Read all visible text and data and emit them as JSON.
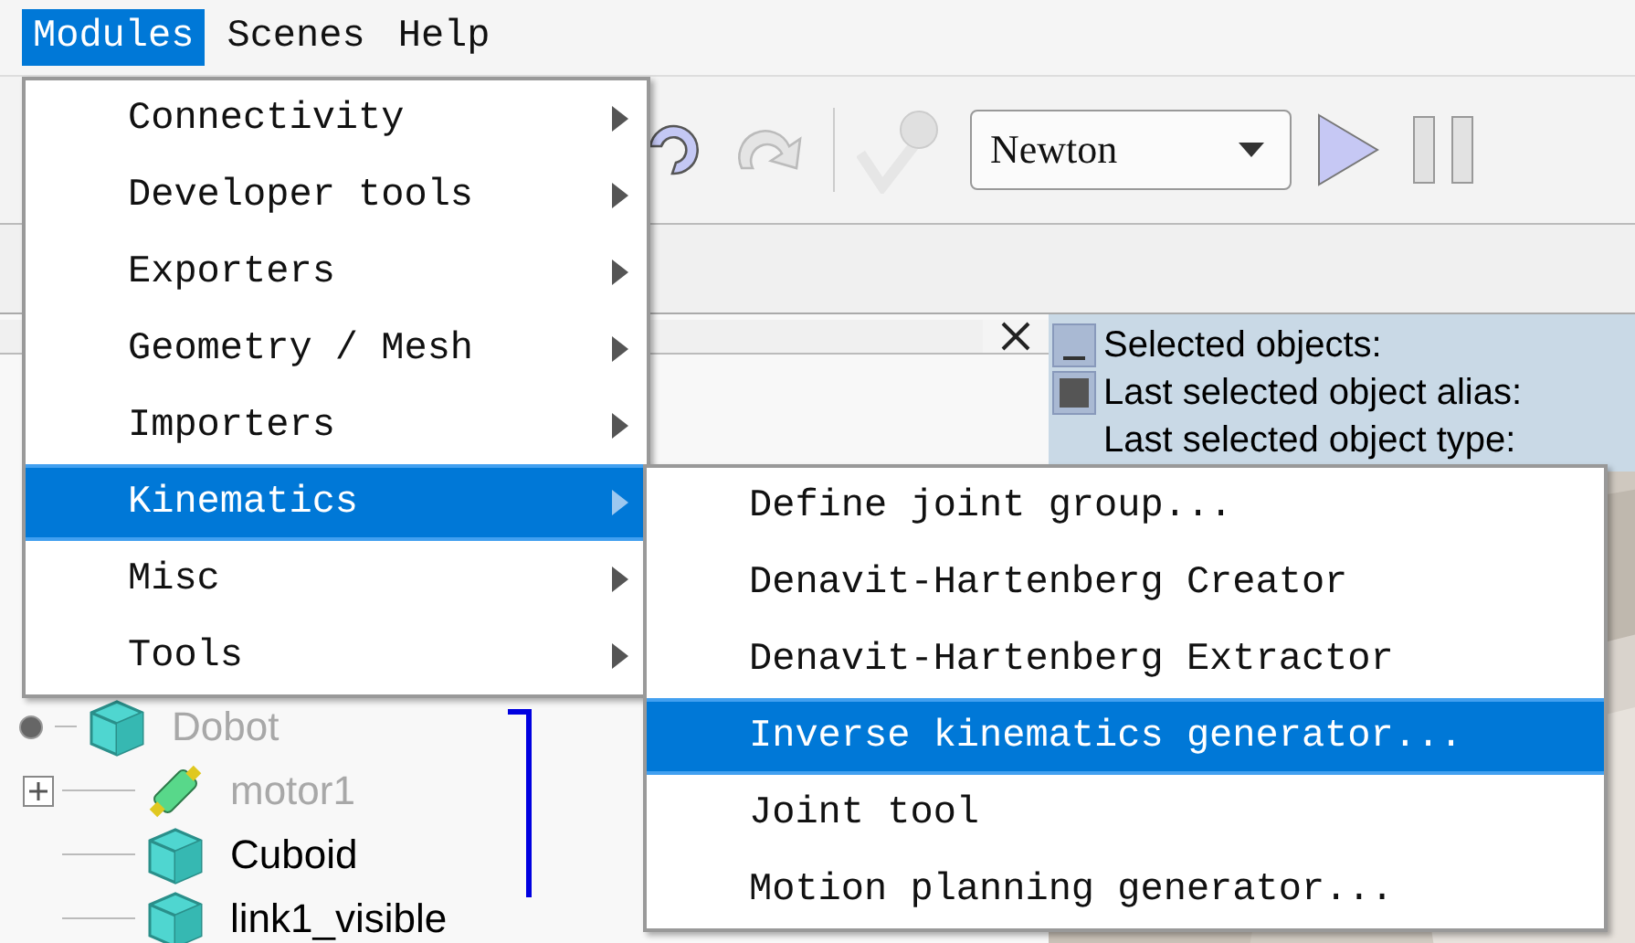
{
  "menubar": [
    {
      "label": "Modules",
      "selected": true
    },
    {
      "label": "Scenes",
      "selected": false
    },
    {
      "label": "Help",
      "selected": false
    }
  ],
  "toolbar": {
    "engine": "Newton"
  },
  "menu": [
    {
      "label": "Connectivity",
      "submenu": true,
      "selected": false
    },
    {
      "label": "Developer tools",
      "submenu": true,
      "selected": false
    },
    {
      "label": "Exporters",
      "submenu": true,
      "selected": false
    },
    {
      "label": "Geometry / Mesh",
      "submenu": true,
      "selected": false
    },
    {
      "label": "Importers",
      "submenu": true,
      "selected": false
    },
    {
      "label": "Kinematics",
      "submenu": true,
      "selected": true
    },
    {
      "label": "Misc",
      "submenu": true,
      "selected": false
    },
    {
      "label": "Tools",
      "submenu": true,
      "selected": false
    }
  ],
  "submenu": [
    {
      "label": "Define joint group...",
      "selected": false
    },
    {
      "label": "Denavit-Hartenberg Creator",
      "selected": false
    },
    {
      "label": "Denavit-Hartenberg Extractor",
      "selected": false
    },
    {
      "label": "Inverse kinematics generator...",
      "selected": true
    },
    {
      "label": "Joint tool",
      "selected": false
    },
    {
      "label": "Motion planning generator...",
      "selected": false
    }
  ],
  "tree": [
    {
      "label": "Dobot",
      "kind": "shape",
      "disabled": true,
      "children": [
        {
          "label": "motor1",
          "kind": "joint",
          "disabled": true,
          "expanded": false
        },
        {
          "label": "Cuboid",
          "kind": "shape",
          "disabled": false
        },
        {
          "label": "link1_visible",
          "kind": "shape",
          "disabled": false
        }
      ]
    }
  ],
  "info": {
    "lines": [
      "Selected objects:",
      "Last selected object alias:",
      "Last selected object type:"
    ]
  }
}
